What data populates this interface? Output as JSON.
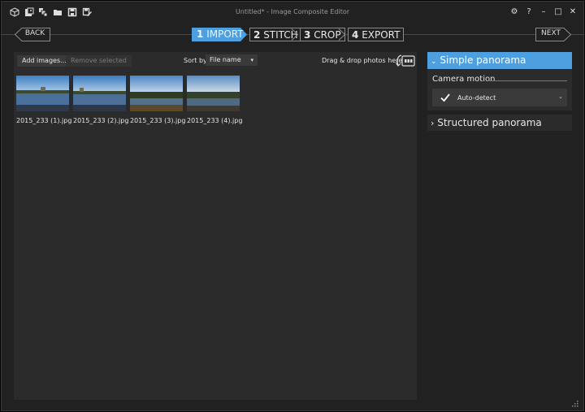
{
  "window": {
    "title": "Untitled* - Image Composite Editor",
    "toolbar_icons": [
      "new-project-icon",
      "open-images-icon",
      "open-image-sequence-icon",
      "open-folder-icon",
      "save-icon",
      "save-as-icon"
    ],
    "controls": {
      "settings": "⚙",
      "help": "?",
      "minimize": "–",
      "maximize": "□",
      "close": "✕"
    }
  },
  "nav": {
    "back": "BACK",
    "next": "NEXT",
    "steps": [
      {
        "num": "1",
        "label": "IMPORT",
        "active": true
      },
      {
        "num": "2",
        "label": "STITCH",
        "active": false
      },
      {
        "num": "3",
        "label": "CROP",
        "active": false
      },
      {
        "num": "4",
        "label": "EXPORT",
        "active": false
      }
    ]
  },
  "import": {
    "add_images": "Add images...",
    "remove_selected": "Remove selected",
    "sort_by_label": "Sort by",
    "sort_by_value": "File name",
    "drag_drop_text": "Drag & drop photos here",
    "images": [
      {
        "filename": "2015_233 (1).jpg"
      },
      {
        "filename": "2015_233 (2).jpg"
      },
      {
        "filename": "2015_233 (3).jpg"
      },
      {
        "filename": "2015_233 (4).jpg"
      }
    ]
  },
  "panorama": {
    "simple": {
      "label": "Simple panorama",
      "expanded": true,
      "camera_motion_label": "Camera motion",
      "camera_motion_value": "Auto-detect"
    },
    "structured": {
      "label": "Structured panorama",
      "expanded": false
    }
  },
  "colors": {
    "accent": "#4d9fe0",
    "background": "#212121",
    "panel": "#2b2b2b"
  }
}
